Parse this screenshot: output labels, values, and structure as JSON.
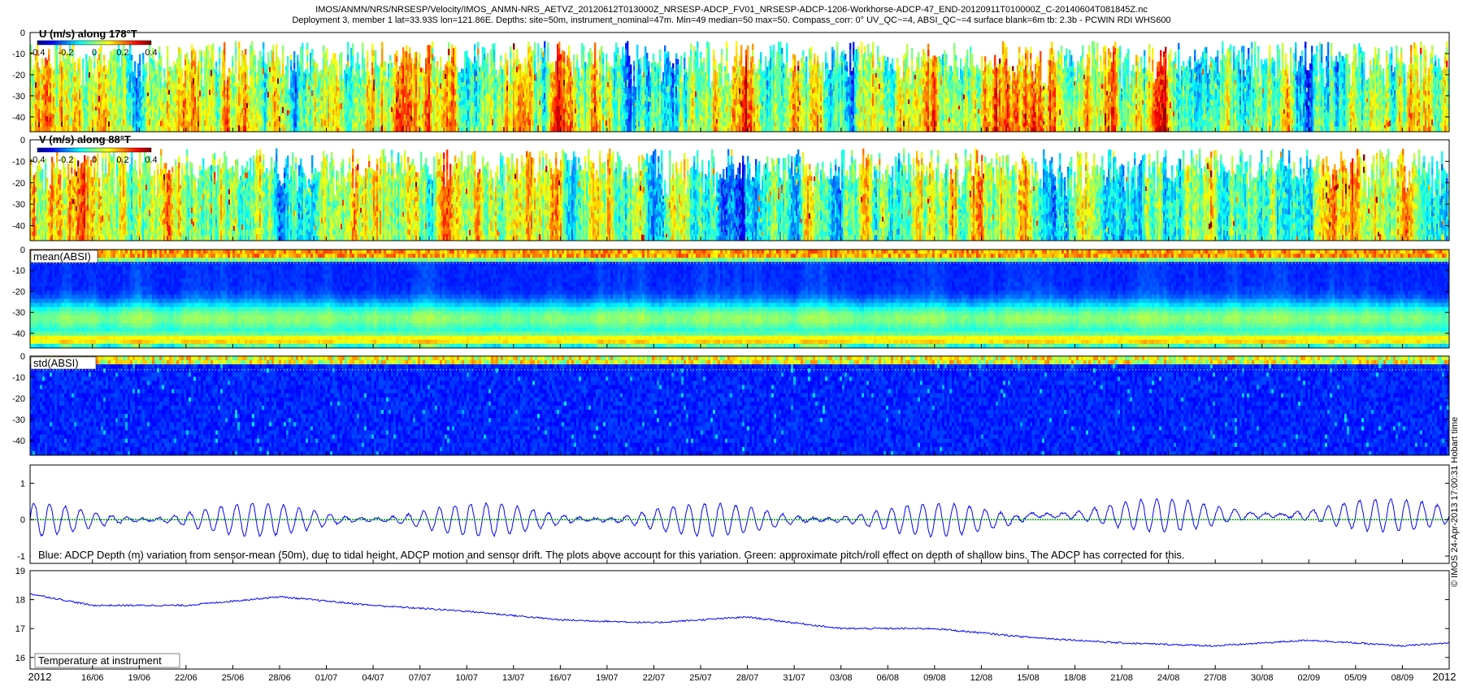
{
  "header": {
    "line1": "IMOS/ANMN/NRS/NRSESP/Velocity/IMOS_ANMN-NRS_AETVZ_20120612T013000Z_NRSESP-ADCP_FV01_NRSESP-ADCP-1206-Workhorse-ADCP-47_END-20120911T010000Z_C-20140604T081845Z.nc",
    "line2": "Deployment 3, member 1 lat=33.93S lon=121.86E. Depths: site=50m, instrument_nominal=47m. Min=49 median=50 max=50. Compass_corr: 0° UV_QC~=4, ABSI_QC~=4 surface blank=6m tb: 2.3b - PCWIN RDI WHS600"
  },
  "side_note": "© IMOS 24-Apr-2013 17:00:31 Hobart time",
  "colors": {
    "depth_series": "#0000ff",
    "pitch_roll_series": "#00a000",
    "temperature_series": "#0000ff",
    "jet_colormap": [
      "#00008f",
      "#0000ff",
      "#00ffff",
      "#ffff00",
      "#ff0000",
      "#800000"
    ]
  },
  "chart_data": [
    {
      "type": "heatmap",
      "label": "U (m/s) along 178°T",
      "colorbar_ticks": [
        "-0.4",
        "-0.2",
        "0",
        "0.2",
        "0.4"
      ],
      "color_range": [
        -0.4,
        0.4
      ],
      "ylim": [
        -47,
        0
      ],
      "yticks": [
        0,
        -10,
        -20,
        -30,
        -40
      ],
      "ytick_labels": [
        "0",
        "-10",
        "-20",
        "-30",
        "-40"
      ],
      "dominant_values": "mostly near 0, some positive patches to 0.3 near bottom"
    },
    {
      "type": "heatmap",
      "label": "V (m/s) along 88°T",
      "colorbar_ticks": [
        "-0.4",
        "-0.2",
        "0",
        "0.2",
        "0.4"
      ],
      "color_range": [
        -0.4,
        0.4
      ],
      "ylim": [
        -47,
        0
      ],
      "yticks": [
        0,
        -10,
        -20,
        -30,
        -40
      ],
      "ytick_labels": [
        "0",
        "-10",
        "-20",
        "-30",
        "-40"
      ]
    },
    {
      "type": "heatmap",
      "label": "mean(ABSI)",
      "ylim": [
        -47,
        0
      ],
      "yticks": [
        0,
        -10,
        -20,
        -30,
        -40
      ],
      "ytick_labels": [
        "0",
        "-10",
        "-20",
        "-30",
        "-40"
      ],
      "features": "high intensity near -5 and -40 to -45 m, low in between"
    },
    {
      "type": "heatmap",
      "label": "std(ABSI)",
      "ylim": [
        -47,
        0
      ],
      "yticks": [
        0,
        -10,
        -20,
        -30,
        -40
      ],
      "ytick_labels": [
        "0",
        "-10",
        "-20",
        "-30",
        "-40"
      ]
    },
    {
      "type": "line",
      "ylim": [
        -1.2,
        1.5
      ],
      "yticks": [
        1,
        0,
        -1
      ],
      "ytick_labels": [
        "1",
        "0",
        "-1"
      ],
      "caption": "Blue: ADCP Depth (m) variation from sensor-mean (50m), due to tidal height, ADCP motion and sensor drift. The plots above account for this variation. Green: approximate pitch/roll effect on depth of shallow bins. The ADCP has corrected for this.",
      "series": [
        {
          "color": "#0000ff",
          "approx_amplitude_m": 0.45,
          "approx_period_days": 1.0
        },
        {
          "color": "#00a000",
          "approx_value": 0
        }
      ]
    },
    {
      "type": "line",
      "ylim": [
        15.6,
        19.0
      ],
      "yticks": [
        19,
        18,
        17,
        16
      ],
      "ytick_labels": [
        "19",
        "18",
        "17",
        "16"
      ],
      "caption": "Temperature at instrument",
      "series": [
        {
          "color": "#0000ff",
          "x": [
            "2012-06-12",
            "2012-06-16",
            "2012-06-22",
            "2012-06-28",
            "2012-07-04",
            "2012-07-10",
            "2012-07-16",
            "2012-07-22",
            "2012-07-28",
            "2012-08-03",
            "2012-08-09",
            "2012-08-15",
            "2012-08-21",
            "2012-08-27",
            "2012-09-02",
            "2012-09-08",
            "2012-09-11"
          ],
          "values": [
            18.2,
            17.8,
            17.8,
            18.1,
            17.8,
            17.6,
            17.3,
            17.2,
            17.4,
            17.0,
            17.0,
            16.7,
            16.5,
            16.4,
            16.6,
            16.4,
            16.5
          ]
        }
      ]
    }
  ],
  "xaxis": {
    "start_label": "2012",
    "end_label": "2012",
    "ticks": [
      "16/06",
      "19/06",
      "22/06",
      "25/06",
      "28/06",
      "01/07",
      "04/07",
      "07/07",
      "10/07",
      "13/07",
      "16/07",
      "19/07",
      "22/07",
      "25/07",
      "28/07",
      "31/07",
      "03/08",
      "06/08",
      "09/08",
      "12/08",
      "15/08",
      "18/08",
      "21/08",
      "24/08",
      "27/08",
      "30/08",
      "02/09",
      "05/09",
      "08/09"
    ]
  }
}
